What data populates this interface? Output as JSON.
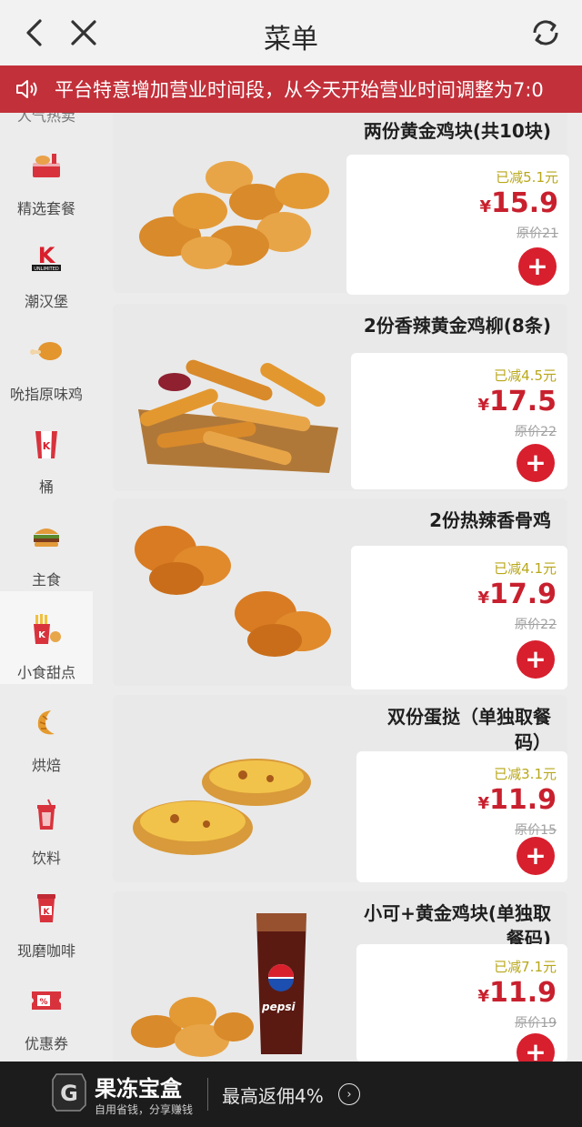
{
  "header": {
    "title": "菜单"
  },
  "notice": {
    "text": "平台特意增加营业时间段，从今天开始营业时间调整为7:0"
  },
  "sidebar": {
    "partial_top_label": "人气热卖",
    "items": [
      {
        "label": "精选套餐",
        "icon": "meal-set-icon"
      },
      {
        "label": "潮汉堡",
        "icon": "unlimited-k-icon"
      },
      {
        "label": "吮指原味鸡",
        "icon": "fried-chicken-icon"
      },
      {
        "label": "桶",
        "icon": "bucket-icon"
      },
      {
        "label": "主食",
        "icon": "burger-icon"
      },
      {
        "label": "小食甜点",
        "icon": "snack-icon",
        "active": true
      },
      {
        "label": "烘焙",
        "icon": "croissant-icon"
      },
      {
        "label": "饮料",
        "icon": "drink-cup-icon"
      },
      {
        "label": "现磨咖啡",
        "icon": "coffee-cup-icon"
      },
      {
        "label": "优惠券",
        "icon": "coupon-icon"
      }
    ]
  },
  "products": [
    {
      "name": "两份黄金鸡块(共10块)",
      "discount": "已减5.1元",
      "yen": "¥",
      "price": "15.9",
      "original": "原价21",
      "add": "+"
    },
    {
      "name": "2份香辣黄金鸡柳(8条)",
      "discount": "已减4.5元",
      "yen": "¥",
      "price": "17.5",
      "original": "原价22",
      "add": "+"
    },
    {
      "name": "2份热辣香骨鸡",
      "discount": "已减4.1元",
      "yen": "¥",
      "price": "17.9",
      "original": "原价22",
      "add": "+"
    },
    {
      "name_line1": "双份蛋挞（单独取餐",
      "name_line2": "码）",
      "discount": "已减3.1元",
      "yen": "¥",
      "price": "11.9",
      "original": "原价15",
      "add": "+"
    },
    {
      "name_line1": "小可+黄金鸡块(单独取",
      "name_line2": "餐码)",
      "discount": "已减7.1元",
      "yen": "¥",
      "price": "11.9",
      "original": "原价19",
      "add": "+",
      "cup_text": "pepsi"
    }
  ],
  "ad": {
    "name": "果冻宝盒",
    "sub": "自用省钱，分享赚钱",
    "offer": "最高返佣4%",
    "arrow": "›"
  },
  "colors": {
    "brand_red": "#c2303a",
    "price_red": "#c8202e",
    "discount_olive": "#b8a71a"
  }
}
